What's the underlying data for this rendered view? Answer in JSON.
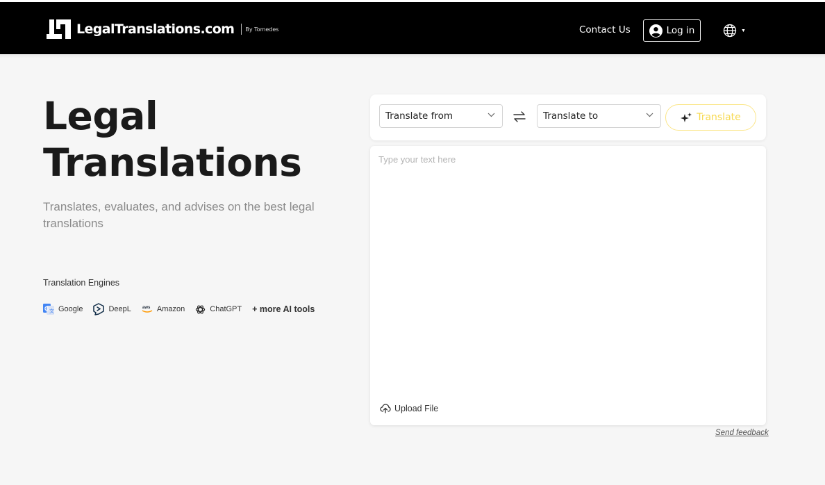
{
  "header": {
    "logo_text": "LegalTranslations.com",
    "logo_by": "By Tomedes",
    "contact_label": "Contact Us",
    "login_label": "Log in",
    "language_icon": "globe-icon"
  },
  "hero": {
    "title_line1": "Legal",
    "title_line2": "Translations",
    "subtitle": "Translates, evaluates, and advises on the best legal translations"
  },
  "engines": {
    "label": "Translation Engines",
    "items": [
      {
        "name": "Google",
        "icon": "google-translate-icon"
      },
      {
        "name": "DeepL",
        "icon": "deepl-icon"
      },
      {
        "name": "Amazon",
        "icon": "aws-icon"
      },
      {
        "name": "ChatGPT",
        "icon": "openai-icon"
      }
    ],
    "more_label": "+ more AI tools"
  },
  "translator": {
    "from_label": "Translate from",
    "to_label": "Translate to",
    "translate_label": "Translate",
    "placeholder": "Type your text here",
    "upload_label": "Upload File",
    "feedback_label": "Send feedback"
  },
  "colors": {
    "navbar": "#000000",
    "background": "#f6f6f6",
    "accent_yellow": "#f7d94f"
  }
}
